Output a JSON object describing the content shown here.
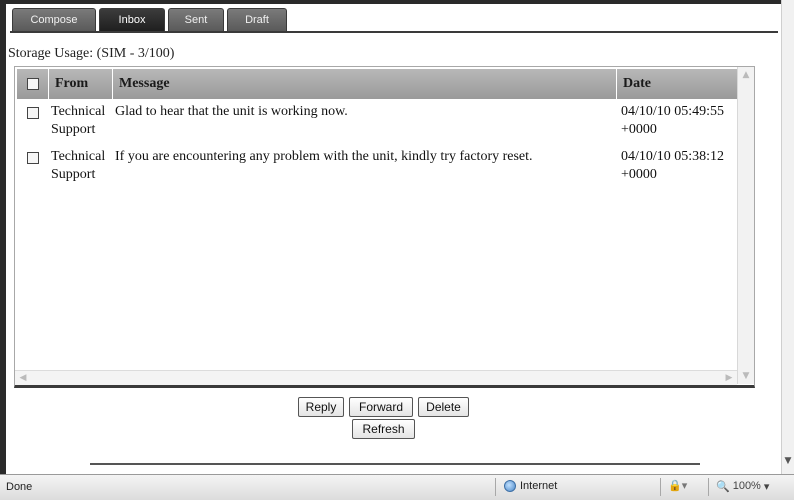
{
  "tabs": [
    {
      "label": "Compose",
      "active": false
    },
    {
      "label": "Inbox",
      "active": true
    },
    {
      "label": "Sent",
      "active": false
    },
    {
      "label": "Draft",
      "active": false
    }
  ],
  "storage_usage": "Storage Usage: (SIM - 3/100)",
  "table": {
    "columns": [
      "From",
      "Message",
      "Date"
    ],
    "rows": [
      {
        "from_line1": "Technical",
        "from_line2": "Support",
        "message": "Glad to hear that the unit is working now.",
        "date_line1": "04/10/10 05:49:55",
        "date_line2": "+0000"
      },
      {
        "from_line1": "Technical",
        "from_line2": "Support",
        "message": "If you are encountering any problem with the unit, kindly try factory reset.",
        "date_line1": "04/10/10 05:38:12",
        "date_line2": "+0000"
      }
    ]
  },
  "buttons": {
    "reply": "Reply",
    "forward": "Forward",
    "delete": "Delete",
    "refresh": "Refresh"
  },
  "statusbar": {
    "status": "Done",
    "zone": "Internet",
    "zoom": "100%",
    "icons": [
      "globe-icon",
      "protected-mode-icon",
      "zoom-icon"
    ]
  },
  "colors": {
    "tab_active": "#2b2b2b",
    "tab_inactive": "#6a6a6a",
    "header_bg": "#a9a9a9"
  }
}
